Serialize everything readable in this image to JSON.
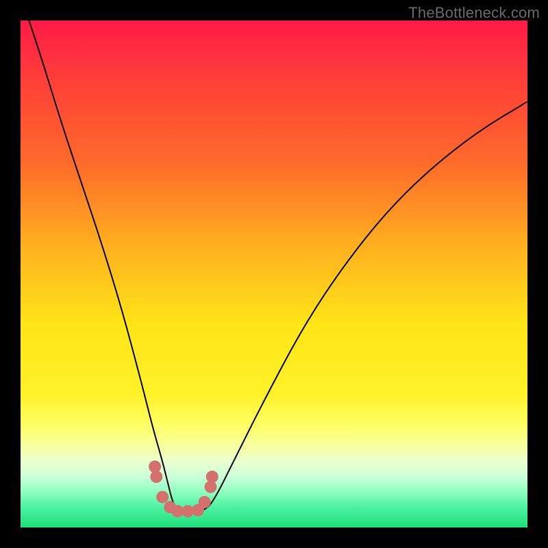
{
  "watermark": "TheBottleneck.com",
  "chart_data": {
    "type": "line",
    "title": "",
    "xlabel": "",
    "ylabel": "",
    "xlim": [
      0,
      100
    ],
    "ylim": [
      0,
      100
    ],
    "grid": false,
    "series": [
      {
        "name": "curve",
        "x": [
          0.5,
          1,
          4,
          8,
          12,
          16,
          20,
          24,
          26,
          28,
          29,
          30,
          31,
          32,
          34,
          36,
          38,
          42,
          48,
          56,
          64,
          72,
          80,
          90,
          100
        ],
        "values": [
          104,
          102,
          93,
          80,
          68,
          56,
          43,
          28,
          20,
          13,
          9,
          5,
          3.2,
          3.2,
          3.2,
          3.2,
          5,
          13,
          25,
          40,
          52,
          62,
          70,
          78,
          84
        ]
      }
    ],
    "markers": {
      "name": "points",
      "x": [
        26.5,
        26.8,
        28.0,
        29.5,
        31.0,
        33.0,
        35.0,
        36.3,
        37.5,
        37.8
      ],
      "values": [
        12.0,
        10.0,
        6.0,
        4.0,
        3.2,
        3.2,
        3.4,
        5.0,
        8.0,
        10.0
      ]
    },
    "background_gradient_stops": [
      {
        "pos": 0,
        "color": "#ff1a47"
      },
      {
        "pos": 10,
        "color": "#ff3a3a"
      },
      {
        "pos": 28,
        "color": "#ff6a2a"
      },
      {
        "pos": 45,
        "color": "#ffb21f"
      },
      {
        "pos": 60,
        "color": "#ffe516"
      },
      {
        "pos": 74,
        "color": "#fff22a"
      },
      {
        "pos": 80,
        "color": "#ffff66"
      },
      {
        "pos": 84,
        "color": "#f7ffa0"
      },
      {
        "pos": 87,
        "color": "#eaffd0"
      },
      {
        "pos": 90,
        "color": "#caffd9"
      },
      {
        "pos": 93,
        "color": "#8fffc0"
      },
      {
        "pos": 96,
        "color": "#4ef2a0"
      },
      {
        "pos": 100,
        "color": "#1fe07a"
      }
    ]
  }
}
